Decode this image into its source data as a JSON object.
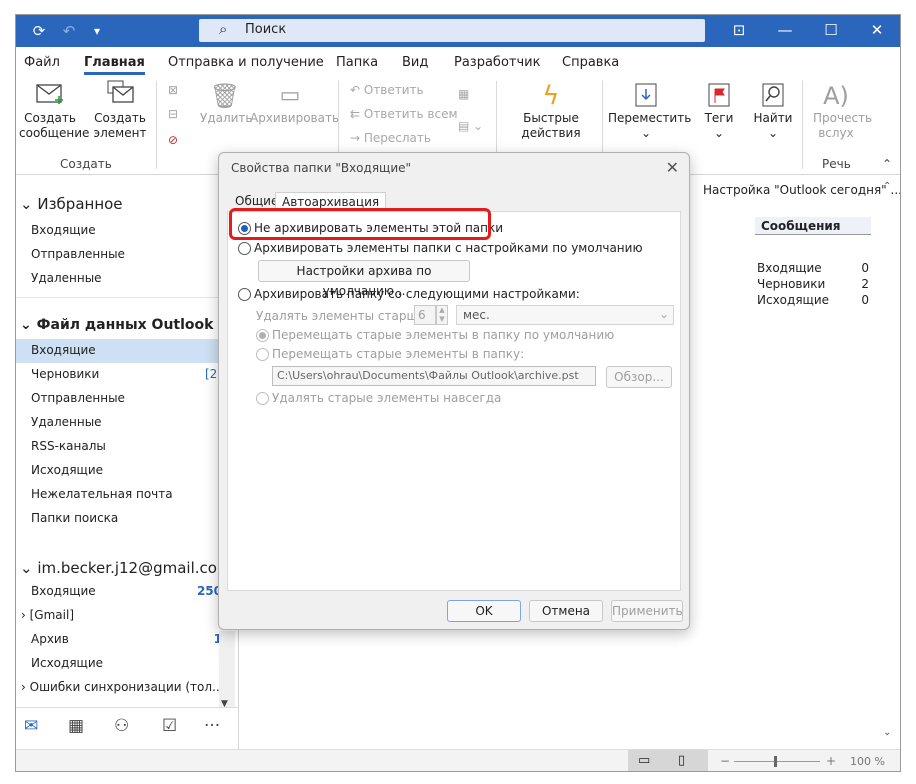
{
  "title_bar": {
    "search_label": "Поиск"
  },
  "ribbon": {
    "tabs": [
      "Файл",
      "Главная",
      "Отправка и получение",
      "Папка",
      "Вид",
      "Разработчик",
      "Справка"
    ],
    "new_message": "Создать сообщение",
    "new_item": "Создать элемент",
    "group_create": "Создать",
    "delete": "Удалить",
    "archive": "Архивировать",
    "reply": "Ответить",
    "reply_all": "Ответить всем",
    "forward": "Переслать",
    "quick_steps": "Быстрые действия",
    "move": "Переместить",
    "tags": "Теги",
    "find": "Найти",
    "read_aloud": "Прочесть вслух",
    "group_speech": "Речь"
  },
  "nav": {
    "favorites": "Избранное",
    "fav_items": [
      "Входящие",
      "Отправленные",
      "Удаленные"
    ],
    "datafile": "Файл данных Outlook",
    "datafile_items": [
      {
        "label": "Входящие",
        "count": ""
      },
      {
        "label": "Черновики",
        "count": "[2]"
      },
      {
        "label": "Отправленные",
        "count": ""
      },
      {
        "label": "Удаленные",
        "count": ""
      },
      {
        "label": "RSS-каналы",
        "count": ""
      },
      {
        "label": "Исходящие",
        "count": ""
      },
      {
        "label": "Нежелательная почта",
        "count": ""
      },
      {
        "label": "Папки поиска",
        "count": ""
      }
    ],
    "account": "im.becker.j12@gmail.com",
    "account_items": [
      {
        "label": "Входящие",
        "count": "250"
      },
      {
        "label": "[Gmail]",
        "count": ""
      },
      {
        "label": "Архив",
        "count": "1"
      },
      {
        "label": "Исходящие",
        "count": ""
      },
      {
        "label": "Ошибки синхронизации (тол...",
        "count": ""
      }
    ]
  },
  "reading_pane": {
    "header": "Настройка \"Outlook сегодня\" ...",
    "messages_title": "Сообщения",
    "rows": [
      {
        "label": "Входящие",
        "count": "0"
      },
      {
        "label": "Черновики",
        "count": "2"
      },
      {
        "label": "Исходящие",
        "count": "0"
      }
    ]
  },
  "status_bar": {
    "zoom": "100 %"
  },
  "dialog": {
    "title": "Свойства папки \"Входящие\"",
    "tab_general": "Общие",
    "tab_autoarchive": "Автоархивация",
    "opt_no_archive": "Не архивировать элементы этой папки",
    "opt_default": "Архивировать элементы папки с настройками по умолчанию",
    "btn_default_settings": "Настройки архива по умолчанию...",
    "opt_custom": "Архивировать папку со следующими настройками:",
    "older_than_label": "Удалять элементы старше",
    "older_than_value": "6",
    "period": "мес.",
    "move_default": "Перемещать старые элементы в папку по умолчанию",
    "move_to": "Перемещать старые элементы в папку:",
    "path": "C:\\Users\\ohrau\\Documents\\Файлы Outlook\\archive.pst",
    "browse": "Обзор...",
    "delete_forever": "Удалять старые элементы навсегда",
    "ok": "OK",
    "cancel": "Отмена",
    "apply": "Применить"
  }
}
